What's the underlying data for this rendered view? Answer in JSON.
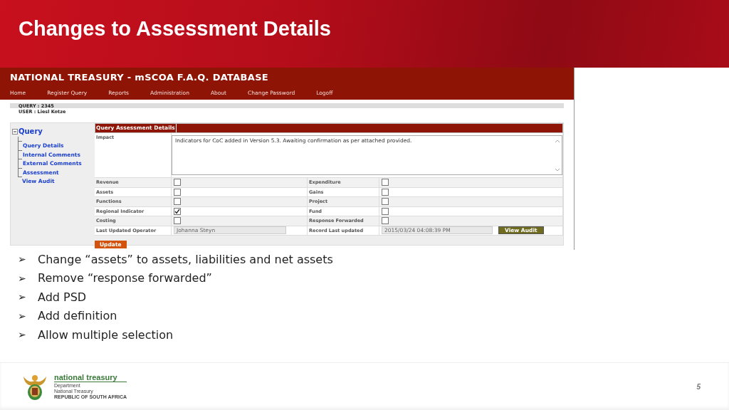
{
  "slide_title": "Changes to Assessment Details",
  "app": {
    "title": "NATIONAL TREASURY - mSCOA F.A.Q. DATABASE",
    "nav": [
      "Home",
      "Register Query",
      "Reports",
      "Administration",
      "About",
      "Change Password",
      "Logoff"
    ],
    "query": "QUERY : 2345",
    "user": "USER : Liesl Kotze",
    "tree": {
      "label": "Query",
      "expanded": true,
      "children": [
        {
          "label": "Query Details"
        },
        {
          "label": "Internal Comments"
        },
        {
          "label": "External Comments"
        },
        {
          "label": "Assessment"
        },
        {
          "label": "View Audit"
        }
      ]
    },
    "section_title": "Query Assessment Details",
    "impact": {
      "label": "Impact",
      "value": "Indicators for CoC added in Version 5.3.  Awaiting confirmation as per attached provided."
    },
    "flags": [
      {
        "label": "Revenue",
        "checked": false
      },
      {
        "label": "Expenditure",
        "checked": false
      },
      {
        "label": "Assets",
        "checked": false
      },
      {
        "label": "Gains",
        "checked": false
      },
      {
        "label": "Functions",
        "checked": false
      },
      {
        "label": "Project",
        "checked": false
      },
      {
        "label": "Regional Indicator",
        "checked": true
      },
      {
        "label": "Fund",
        "checked": false
      },
      {
        "label": "Costing",
        "checked": false
      },
      {
        "label": "Response Forwarded",
        "checked": false
      }
    ],
    "operator": {
      "label": "Last Updated Operator",
      "value": "Johanna Steyn"
    },
    "record": {
      "label": "Record Last updated",
      "value": "2015/03/24 04:08:39 PM"
    },
    "view_audit": "View Audit",
    "update": "Update"
  },
  "bullets": [
    {
      "marker": "➢",
      "text": "Change “assets” to assets, liabilities and net assets"
    },
    {
      "marker": "➢",
      "text": "Remove “response forwarded”"
    },
    {
      "marker": "➢",
      "text": "Add PSD"
    },
    {
      "marker": "➢",
      "text": "Add definition"
    },
    {
      "marker": "➢",
      "text": "Allow multiple selection"
    }
  ],
  "footer": {
    "logo_title": "national treasury",
    "logo_lines": [
      "Department",
      "National Treasury",
      "REPUBLIC OF SOUTH AFRICA"
    ],
    "page": "5"
  }
}
